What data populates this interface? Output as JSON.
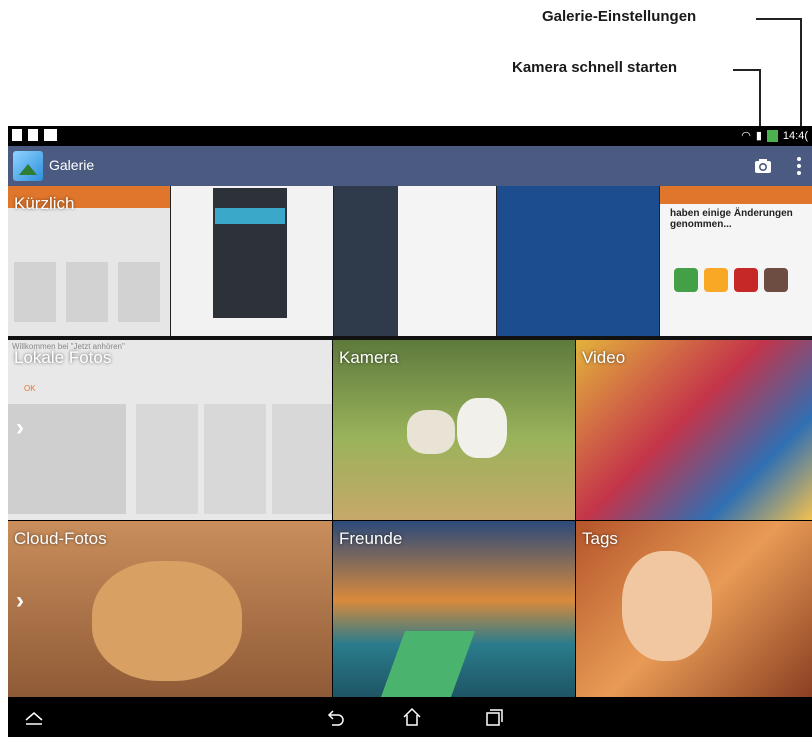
{
  "annotations": {
    "settings_label": "Galerie-Einstellungen",
    "camera_label": "Kamera schnell starten"
  },
  "statusbar": {
    "time": "14:4("
  },
  "actionbar": {
    "title": "Galerie",
    "camera_icon": "camera-icon",
    "menu_icon": "overflow-menu-icon"
  },
  "albums": {
    "recent": "Kürzlich",
    "local": "Lokale Fotos",
    "camera": "Kamera",
    "video": "Video",
    "cloud": "Cloud-Fotos",
    "friends": "Freunde",
    "tags": "Tags"
  },
  "thumb_texts": {
    "recent_banner": "haben einige Änderungen\ngenommen...",
    "local_welcome": "Willkommen bei \"Jetzt anhören\"",
    "local_ok": "OK"
  },
  "navbar": {
    "icons": [
      "collapse-icon",
      "back-icon",
      "home-icon",
      "recent-apps-icon"
    ]
  },
  "colors": {
    "actionbar": "#4a5a80",
    "accent": "#e0762b"
  }
}
